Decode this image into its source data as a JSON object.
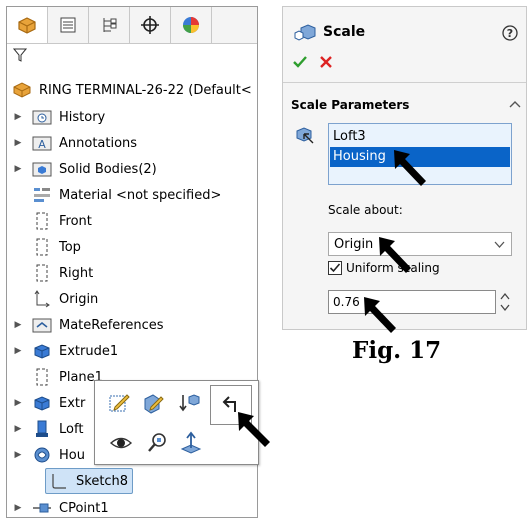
{
  "tree": {
    "tabs": [
      "feature-manager-icon",
      "property-manager-icon",
      "configuration-manager-icon",
      "dimxpert-icon",
      "display-manager-icon"
    ],
    "root_label": "RING TERMINAL-26-22  (Default<",
    "items": [
      {
        "label": "History",
        "icon": "history-folder-icon",
        "expand": true
      },
      {
        "label": "Annotations",
        "icon": "annotations-folder-icon",
        "expand": true
      },
      {
        "label": "Solid Bodies(2)",
        "icon": "solid-bodies-folder-icon",
        "expand": true
      },
      {
        "label": "Material <not specified>",
        "icon": "material-icon",
        "expand": false
      },
      {
        "label": "Front",
        "icon": "plane-icon",
        "expand": false
      },
      {
        "label": "Top",
        "icon": "plane-icon",
        "expand": false
      },
      {
        "label": "Right",
        "icon": "plane-icon",
        "expand": false
      },
      {
        "label": "Origin",
        "icon": "origin-icon",
        "expand": false
      },
      {
        "label": "MateReferences",
        "icon": "mate-references-folder-icon",
        "expand": true
      },
      {
        "label": "Extrude1",
        "icon": "extrude-icon",
        "expand": true
      },
      {
        "label": "Plane1",
        "icon": "plane-icon",
        "expand": false
      },
      {
        "label": "Extr",
        "icon": "extrude-icon",
        "expand": true
      },
      {
        "label": "Loft",
        "icon": "loft-icon",
        "expand": true
      },
      {
        "label": "Hou",
        "icon": "housing-icon",
        "expand": true
      }
    ],
    "selected_item": "Sketch8",
    "last_item": "CPoint1"
  },
  "context_toolbar": {
    "buttons": [
      "edit-sketch-icon",
      "edit-feature-icon",
      "rollback-icon",
      "back-arrow-icon",
      "show-icon",
      "zoom-to-selection-icon",
      "normal-to-icon"
    ]
  },
  "scale_pm": {
    "title": "Scale",
    "section": "Scale Parameters",
    "bodies": [
      "Loft3",
      "Housing"
    ],
    "scale_about_label": "Scale about:",
    "scale_about_value": "Origin",
    "uniform_label": "Uniform scaling",
    "uniform_checked": true,
    "scale_value": "0.76"
  },
  "figure_caption": "Fig. 17"
}
